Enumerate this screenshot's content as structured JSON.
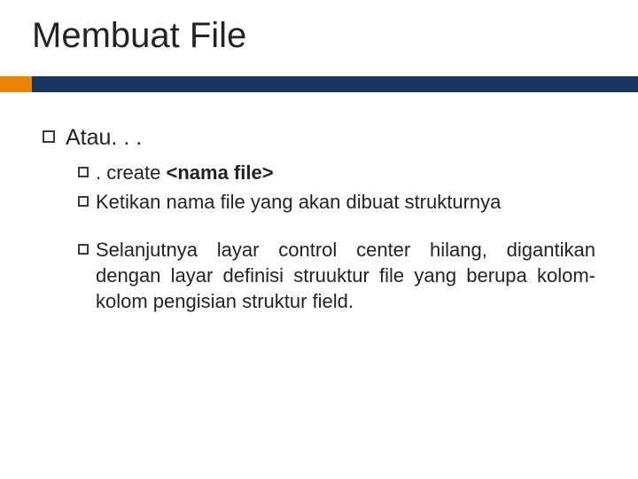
{
  "title": "Membuat File",
  "body": {
    "item1": "Atau. . .",
    "sub1_prefix": ". create ",
    "sub1_bold": "<nama file>",
    "sub2_lead": "Ketikan ",
    "sub2_rest": "nama file yang akan dibuat strukturnya",
    "sub3_lead": "Selanjutnya ",
    "sub3_rest": "layar control center hilang, digantikan dengan layar definisi struuktur file yang berupa kolom- kolom pengisian struktur field."
  }
}
